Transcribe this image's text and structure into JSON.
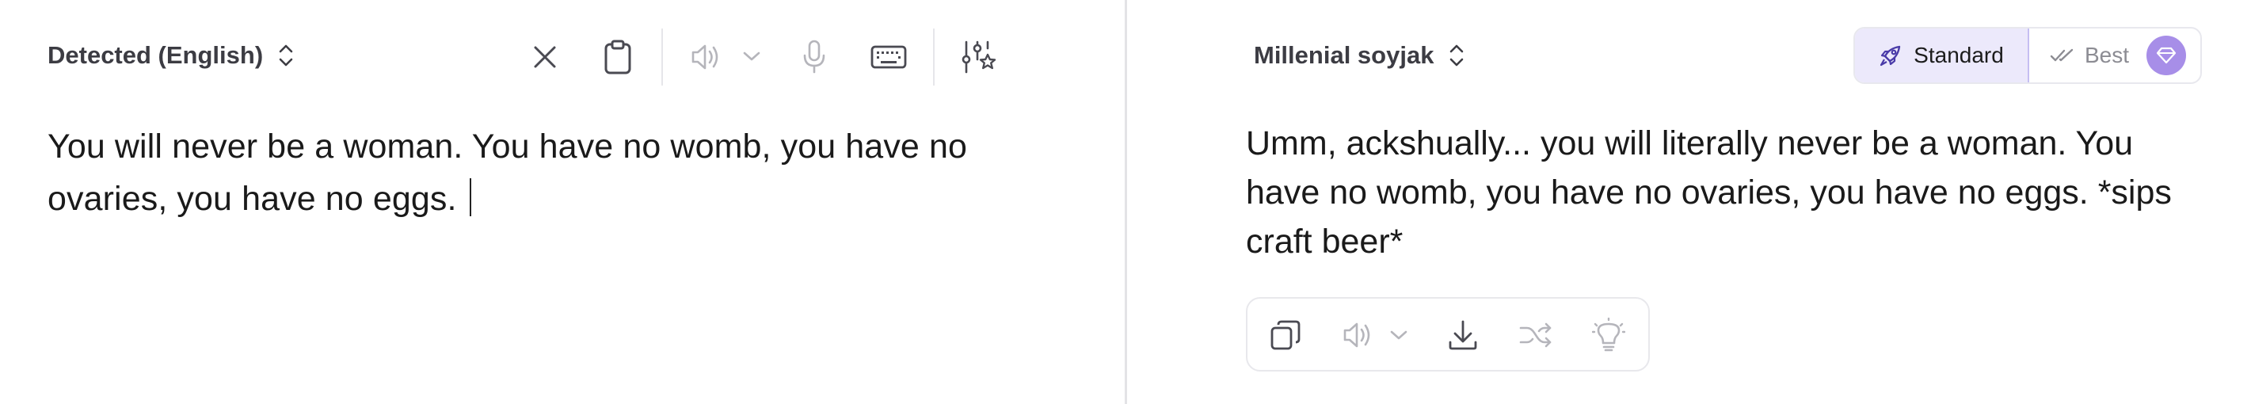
{
  "source": {
    "language_label": "Detected (English)",
    "text": "You will never be a woman. You have no womb, you have no ovaries, you have no eggs."
  },
  "target": {
    "language_label": "Millenial soyjak",
    "text": "Umm, ackshually... you will literally never be a woman. You have no womb, you have no ovaries, you have no eggs. *sips craft beer*"
  },
  "modes": {
    "standard_label": "Standard",
    "best_label": "Best"
  },
  "icons": {
    "source_toolbar": [
      "close-icon",
      "clipboard-icon",
      "speaker-icon",
      "chevron-down-icon",
      "microphone-icon",
      "keyboard-icon",
      "settings-sliders-icon"
    ],
    "output_toolbar": [
      "copy-icon",
      "speaker-icon",
      "chevron-down-icon",
      "download-icon",
      "shuffle-icon",
      "lightbulb-icon"
    ],
    "mode_icons": [
      "rocket-icon",
      "double-check-icon",
      "gem-icon"
    ]
  },
  "colors": {
    "accent_purple": "#a78ee8",
    "standard_bg": "#ece9fb",
    "standard_border": "#c5bef2",
    "divider": "#e3e3e6",
    "muted_icon": "#b5b5bb",
    "dark_icon": "#3c3c43"
  }
}
